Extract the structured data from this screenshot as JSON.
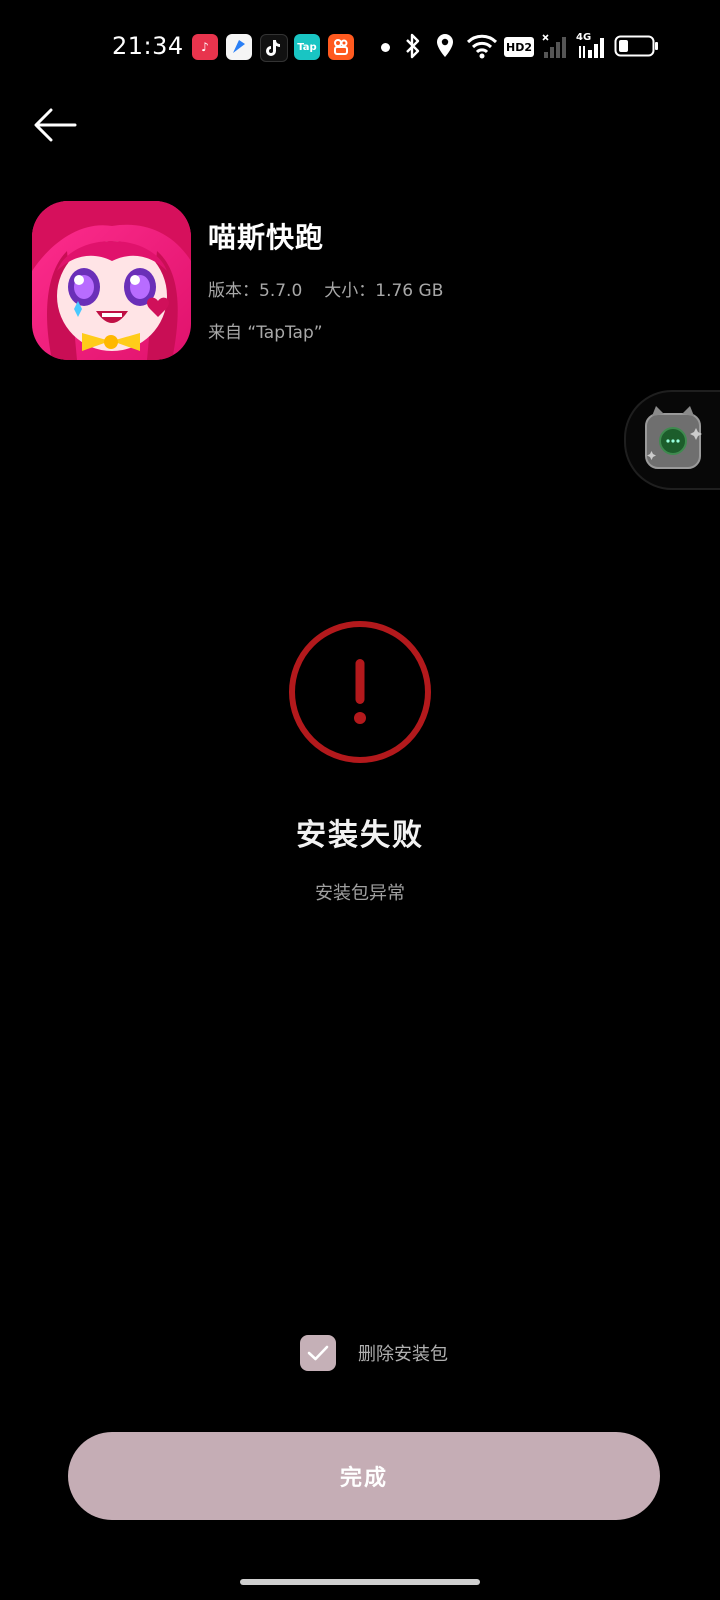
{
  "status_bar": {
    "time": "21:34",
    "notification_icons": [
      {
        "name": "music-app-icon",
        "color": "#e8344d",
        "glyph": "♪"
      },
      {
        "name": "browser-app-icon",
        "color": "#f5f5f5",
        "glyph": ""
      },
      {
        "name": "tiktok-app-icon",
        "color": "#111111",
        "glyph": "♪"
      },
      {
        "name": "taptap-app-icon",
        "color": "#19c5c3",
        "glyph": "Tap"
      },
      {
        "name": "kuaishou-app-icon",
        "color": "#ff5a1f",
        "glyph": "◉"
      }
    ],
    "network_label": "4G",
    "hd_label": "HD2"
  },
  "app": {
    "name": "喵斯快跑",
    "version_label": "版本：",
    "version": "5.7.0",
    "size_label": "大小：",
    "size": "1.76 GB",
    "source": "来自 “TapTap”"
  },
  "result": {
    "title": "安装失败",
    "subtitle": "安装包异常",
    "accent_color": "#b3191c"
  },
  "options": {
    "delete_package_label": "删除安装包",
    "delete_package_checked": true
  },
  "actions": {
    "done_label": "完成"
  }
}
